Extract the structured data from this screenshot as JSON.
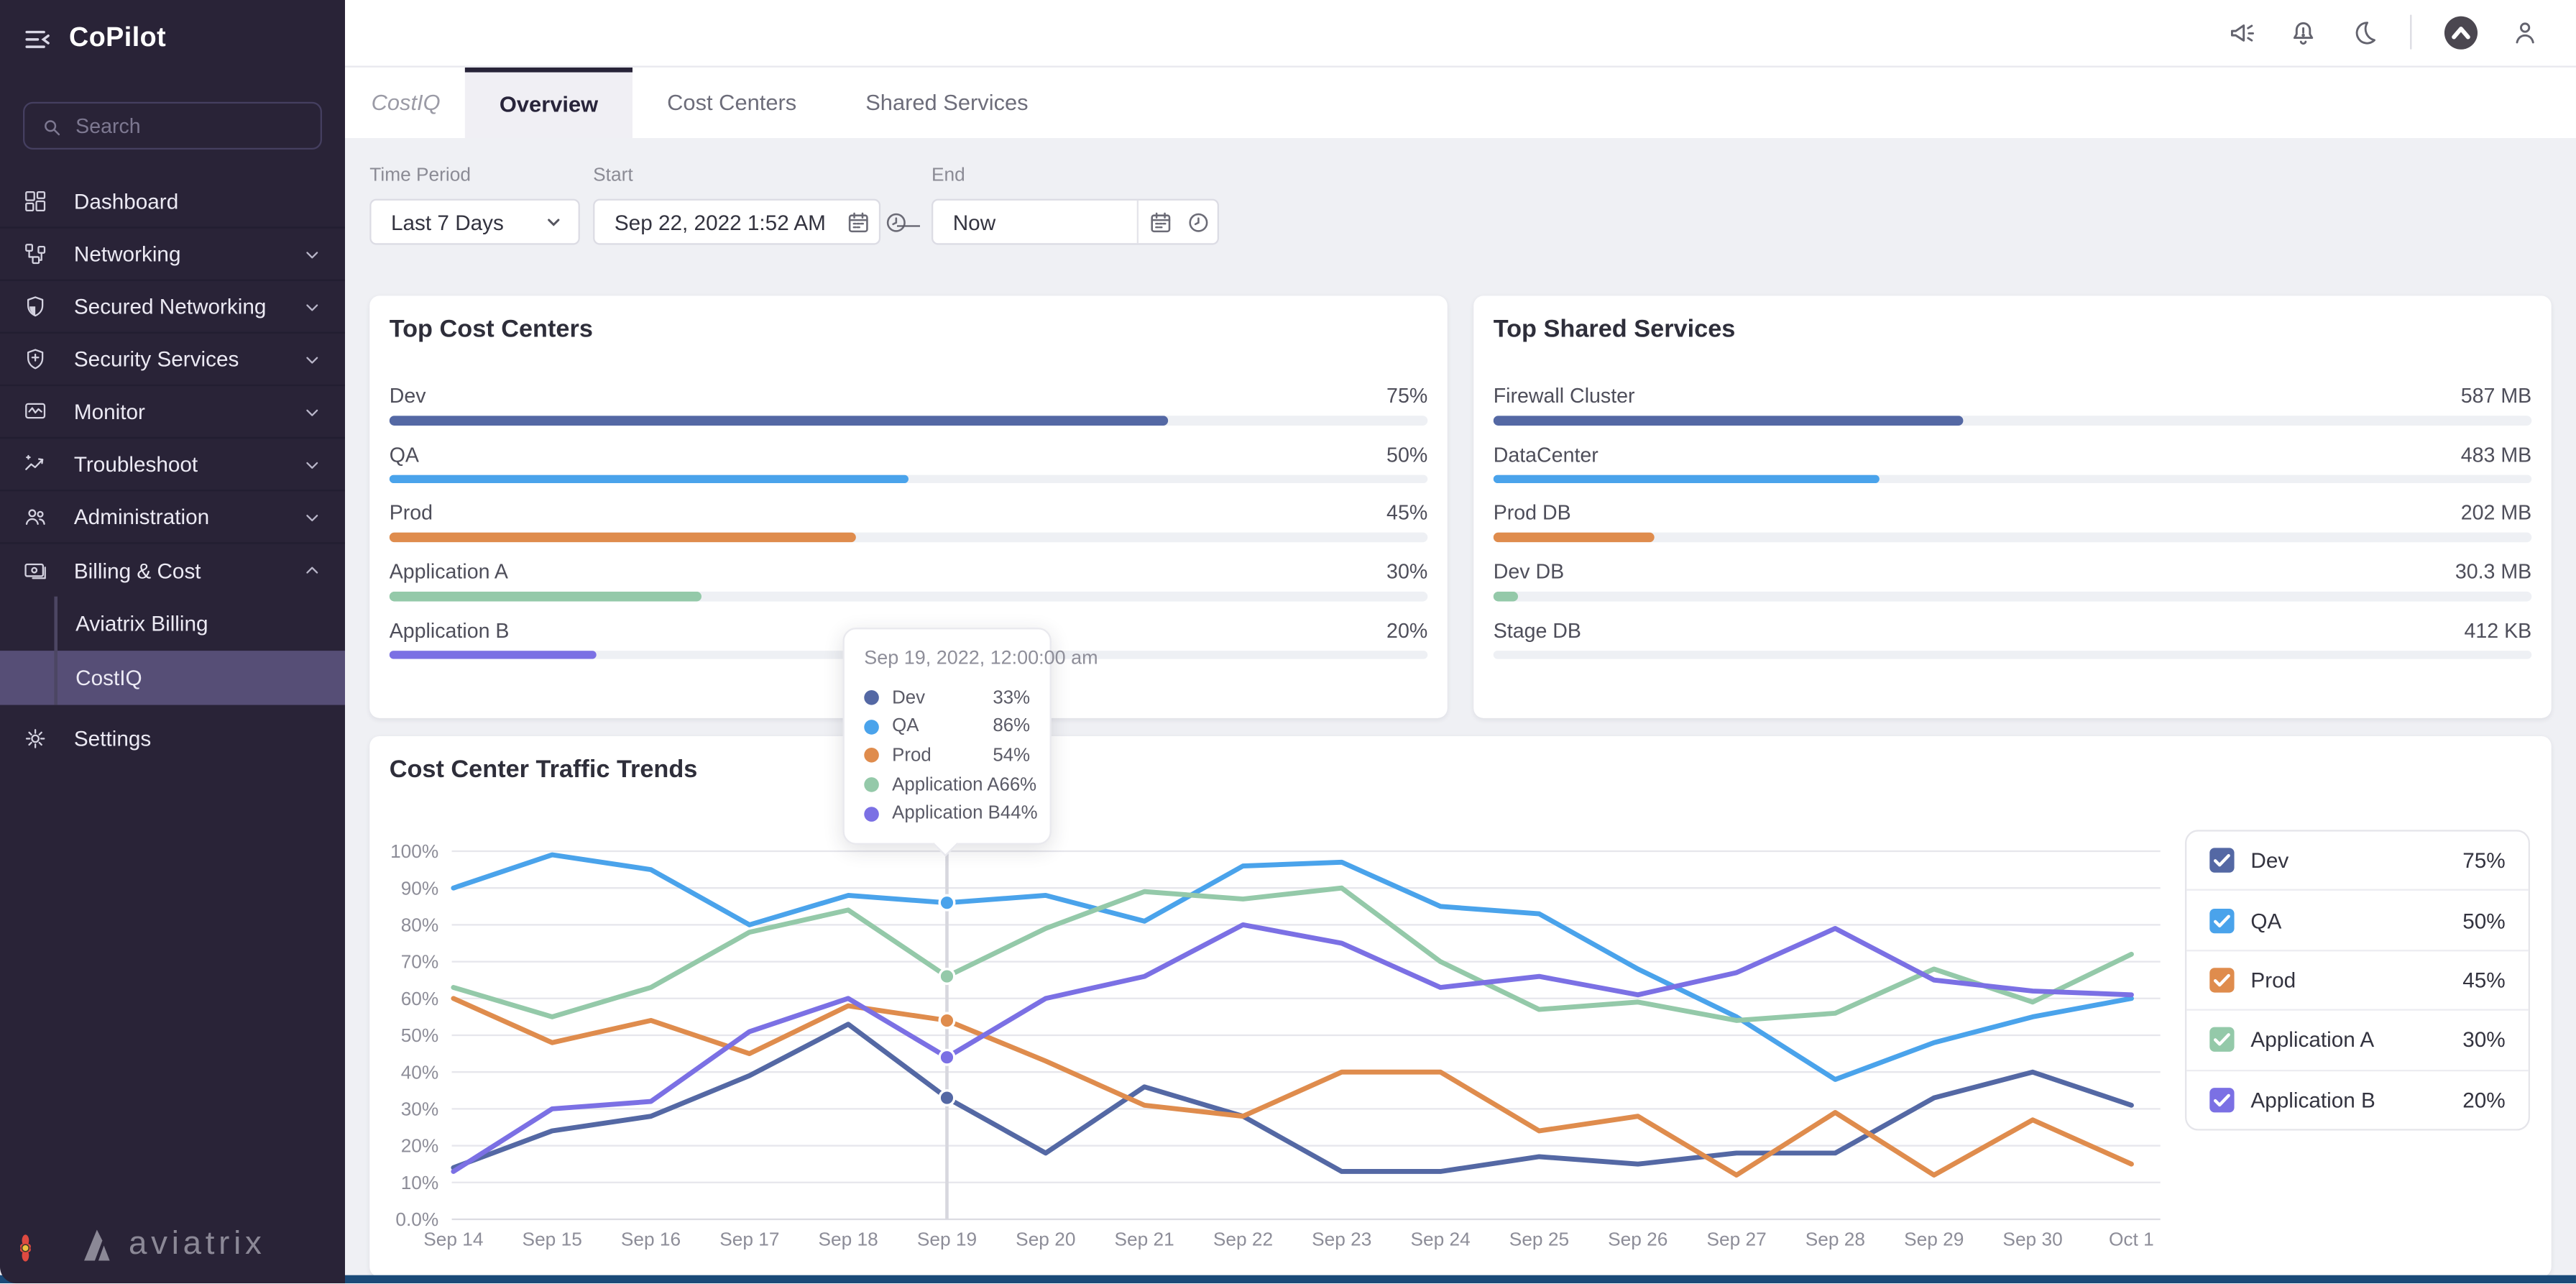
{
  "app": {
    "title": "CoPilot"
  },
  "colors": {
    "sidebar_bg": "#292337",
    "sidebar_active": "#564e76",
    "bottom_bar": "#1a4a78",
    "dev": "#5468a4",
    "qa": "#4aa3eb",
    "prod": "#df8c4d",
    "app_a": "#94c9a9",
    "app_b": "#7b70e4"
  },
  "topbar": {
    "icons": [
      "announcements",
      "notifications",
      "dark-mode",
      "aviatrix",
      "user"
    ]
  },
  "sidebar": {
    "search_placeholder": "Search",
    "footer_logo_text": "aviatrix",
    "items": [
      {
        "label": "Dashboard",
        "icon": "dashboard",
        "divider": true
      },
      {
        "label": "Networking",
        "icon": "networking",
        "chevron": "down",
        "divider": true
      },
      {
        "label": "Secured Networking",
        "icon": "shield-half",
        "chevron": "down",
        "divider": true
      },
      {
        "label": "Security Services",
        "icon": "shield-plus",
        "chevron": "down",
        "divider": true
      },
      {
        "label": "Monitor",
        "icon": "monitor",
        "chevron": "down",
        "divider": true
      },
      {
        "label": "Troubleshoot",
        "icon": "trend",
        "chevron": "down",
        "divider": true
      },
      {
        "label": "Administration",
        "icon": "people",
        "chevron": "down",
        "divider": true
      },
      {
        "label": "Billing & Cost",
        "icon": "billing",
        "chevron": "up"
      },
      {
        "label": "Aviatrix Billing",
        "sub": true
      },
      {
        "label": "CostIQ",
        "sub": true,
        "active": true
      },
      {
        "label": "Settings",
        "icon": "gear",
        "settings": true
      }
    ]
  },
  "tabs": {
    "context_label": "CostIQ",
    "items": [
      "Overview",
      "Cost Centers",
      "Shared Services"
    ],
    "active": "Overview"
  },
  "filters": {
    "time_period": {
      "label": "Time Period",
      "value": "Last 7 Days"
    },
    "start": {
      "label": "Start",
      "value": "Sep 22, 2022 1:52 AM"
    },
    "separator": "—",
    "end": {
      "label": "End",
      "value": "Now"
    }
  },
  "cards": {
    "top_cost_centers": {
      "title": "Top Cost Centers",
      "rows": [
        {
          "label": "Dev",
          "value": "75%",
          "pct": 75,
          "color": "#5468a4"
        },
        {
          "label": "QA",
          "value": "50%",
          "pct": 50,
          "color": "#4aa3eb"
        },
        {
          "label": "Prod",
          "value": "45%",
          "pct": 45,
          "color": "#df8c4d"
        },
        {
          "label": "Application A",
          "value": "30%",
          "pct": 30,
          "color": "#94c9a9"
        },
        {
          "label": "Application B",
          "value": "20%",
          "pct": 20,
          "color": "#7b70e4"
        }
      ]
    },
    "top_shared_services": {
      "title": "Top Shared Services",
      "rows": [
        {
          "label": "Firewall Cluster",
          "value": "587 MB",
          "pct": 45.2,
          "color": "#5468a4"
        },
        {
          "label": "DataCenter",
          "value": "483 MB",
          "pct": 37.2,
          "color": "#4aa3eb"
        },
        {
          "label": "Prod DB",
          "value": "202 MB",
          "pct": 15.5,
          "color": "#df8c4d"
        },
        {
          "label": "Dev DB",
          "value": "30.3 MB",
          "pct": 2.4,
          "color": "#94c9a9"
        },
        {
          "label": "Stage DB",
          "value": "412 KB",
          "pct": 0,
          "color": "#7b70e4"
        }
      ]
    }
  },
  "tooltip": {
    "title": "Sep 19, 2022, 12:00:00 am",
    "rows": [
      {
        "name": "Dev",
        "value": "33%",
        "color": "#5468a4"
      },
      {
        "name": "QA",
        "value": "86%",
        "color": "#4aa3eb"
      },
      {
        "name": "Prod",
        "value": "54%",
        "color": "#df8c4d"
      },
      {
        "name": "Application A",
        "value": "66%",
        "color": "#94c9a9"
      },
      {
        "name": "Application B",
        "value": "44%",
        "color": "#7b70e4"
      }
    ]
  },
  "legend": {
    "rows": [
      {
        "label": "Dev",
        "value": "75%",
        "color": "#5468a4",
        "checked": true
      },
      {
        "label": "QA",
        "value": "50%",
        "color": "#4aa3eb",
        "checked": true
      },
      {
        "label": "Prod",
        "value": "45%",
        "color": "#df8c4d",
        "checked": true
      },
      {
        "label": "Application A",
        "value": "30%",
        "color": "#94c9a9",
        "checked": true
      },
      {
        "label": "Application B",
        "value": "20%",
        "color": "#7b70e4",
        "checked": true
      }
    ]
  },
  "chart_data": {
    "type": "line",
    "title": "Cost Center Traffic Trends",
    "unit": "%",
    "ylim": [
      0,
      100
    ],
    "grid": true,
    "legend_position": "right",
    "hover_index": 5,
    "y_ticks": [
      "0.0%",
      "10%",
      "20%",
      "30%",
      "40%",
      "50%",
      "60%",
      "70%",
      "80%",
      "90%",
      "100%"
    ],
    "x": [
      "Sep 14",
      "Sep 15",
      "Sep 16",
      "Sep 17",
      "Sep 18",
      "Sep 19",
      "Sep 20",
      "Sep 21",
      "Sep 22",
      "Sep 23",
      "Sep 24",
      "Sep 25",
      "Sep 26",
      "Sep 27",
      "Sep 28",
      "Sep 29",
      "Sep 30",
      "Oct 1"
    ],
    "series": [
      {
        "name": "Dev",
        "color": "#5468a4",
        "values": [
          14,
          24,
          28,
          39,
          53,
          33,
          18,
          36,
          28,
          13,
          13,
          17,
          15,
          18,
          18,
          33,
          40,
          31
        ]
      },
      {
        "name": "QA",
        "color": "#4aa3eb",
        "values": [
          90,
          99,
          95,
          80,
          88,
          86,
          88,
          81,
          96,
          97,
          85,
          83,
          68,
          55,
          38,
          48,
          55,
          60
        ]
      },
      {
        "name": "Prod",
        "color": "#df8c4d",
        "values": [
          60,
          48,
          54,
          45,
          58,
          54,
          43,
          31,
          28,
          40,
          40,
          24,
          28,
          12,
          29,
          12,
          27,
          15
        ]
      },
      {
        "name": "Application A",
        "color": "#94c9a9",
        "values": [
          63,
          55,
          63,
          78,
          84,
          66,
          79,
          89,
          87,
          90,
          70,
          57,
          59,
          54,
          56,
          68,
          59,
          72
        ]
      },
      {
        "name": "Application B",
        "color": "#7b70e4",
        "values": [
          13,
          30,
          32,
          51,
          60,
          44,
          60,
          66,
          80,
          75,
          63,
          66,
          61,
          67,
          79,
          65,
          62,
          61
        ]
      }
    ]
  }
}
